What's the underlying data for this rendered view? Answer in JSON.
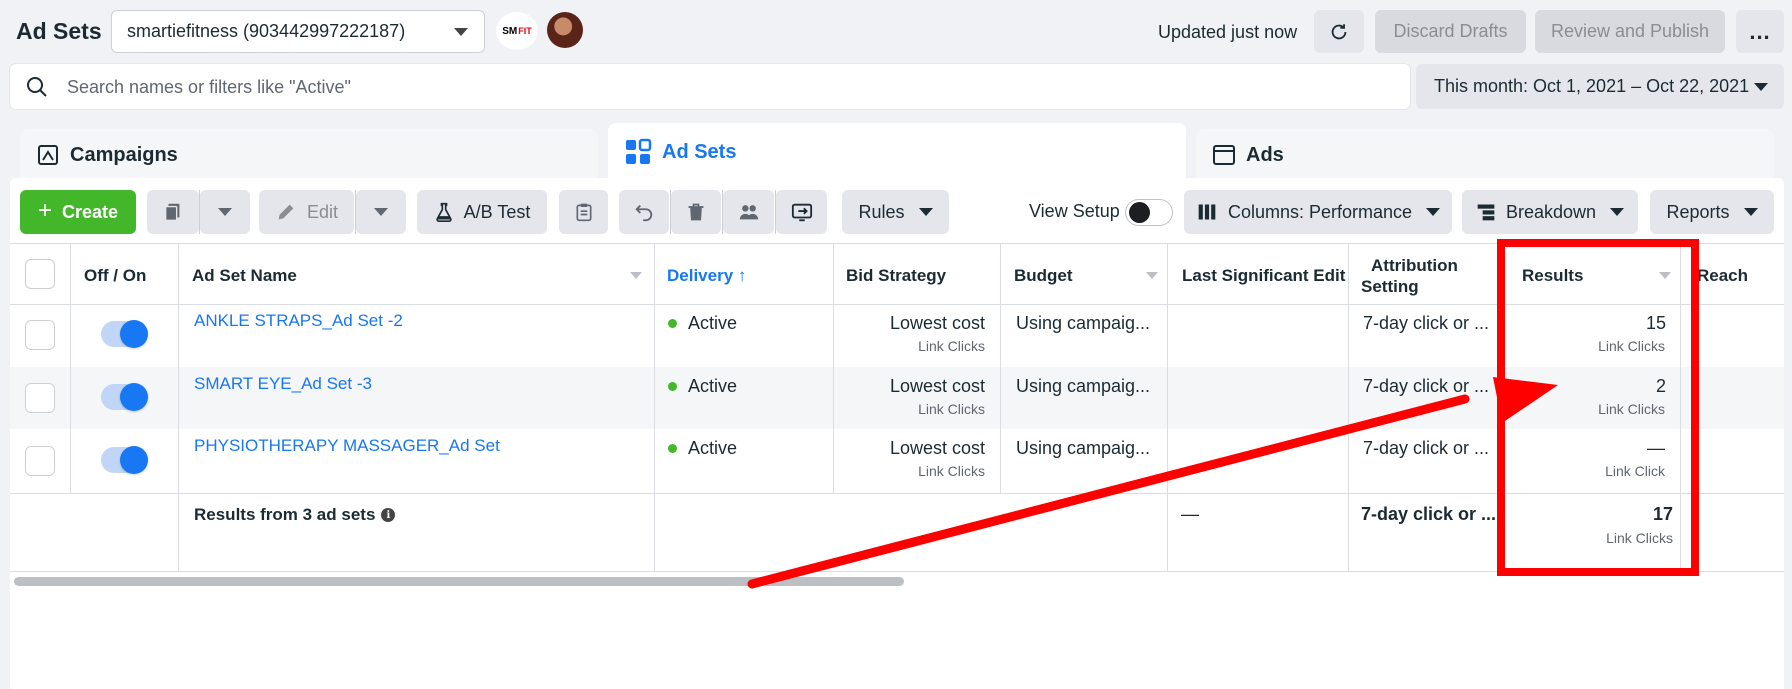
{
  "header": {
    "title": "Ad Sets",
    "account": "smartiefitness (903442997222187)",
    "logo_text": "SM",
    "logo_sub": "FIT",
    "updated": "Updated just now",
    "discard_label": "Discard Drafts",
    "publish_label": "Review and Publish",
    "more_label": "..."
  },
  "search": {
    "placeholder": "Search names or filters like \"Active\""
  },
  "date_range": "This month: Oct 1, 2021 – Oct 22, 2021",
  "tabs": [
    {
      "label": "Campaigns",
      "active": false
    },
    {
      "label": "Ad Sets",
      "active": true
    },
    {
      "label": "Ads",
      "active": false
    }
  ],
  "toolbar": {
    "create": "Create",
    "edit": "Edit",
    "ab_test": "A/B Test",
    "rules": "Rules",
    "view_setup": "View Setup",
    "columns": "Columns: Performance",
    "breakdown": "Breakdown",
    "reports": "Reports"
  },
  "table": {
    "headers": {
      "off_on": "Off / On",
      "name": "Ad Set Name",
      "delivery": "Delivery ↑",
      "bid_strategy": "Bid Strategy",
      "budget": "Budget",
      "last_edit": "Last Significant Edit",
      "attribution_1": "Attribution",
      "attribution_2": "Setting",
      "results": "Results",
      "reach": "Reach"
    },
    "rows": [
      {
        "name": "ANKLE STRAPS_Ad Set -2",
        "delivery": "Active",
        "bid": "Lowest cost",
        "bid_sub": "Link Clicks",
        "budget": "Using campaig...",
        "attribution": "7-day click or ...",
        "results": "15",
        "results_sub": "Link Clicks"
      },
      {
        "name": "SMART EYE_Ad Set -3",
        "delivery": "Active",
        "bid": "Lowest cost",
        "bid_sub": "Link Clicks",
        "budget": "Using campaig...",
        "attribution": "7-day click or ...",
        "results": "2",
        "results_sub": "Link Clicks"
      },
      {
        "name": "PHYSIOTHERAPY MASSAGER_Ad Set",
        "delivery": "Active",
        "bid": "Lowest cost",
        "bid_sub": "Link Clicks",
        "budget": "Using campaig...",
        "attribution": "7-day click or ...",
        "results": "—",
        "results_sub": "Link Click"
      }
    ],
    "summary": {
      "label": "Results from 3 ad sets",
      "last_edit": "—",
      "attribution": "7-day click or ...",
      "results": "17",
      "results_sub": "Link Clicks"
    }
  },
  "colors": {
    "accent": "#1877f2",
    "create_green": "#42b72a",
    "annotation_red": "#ff0000"
  }
}
